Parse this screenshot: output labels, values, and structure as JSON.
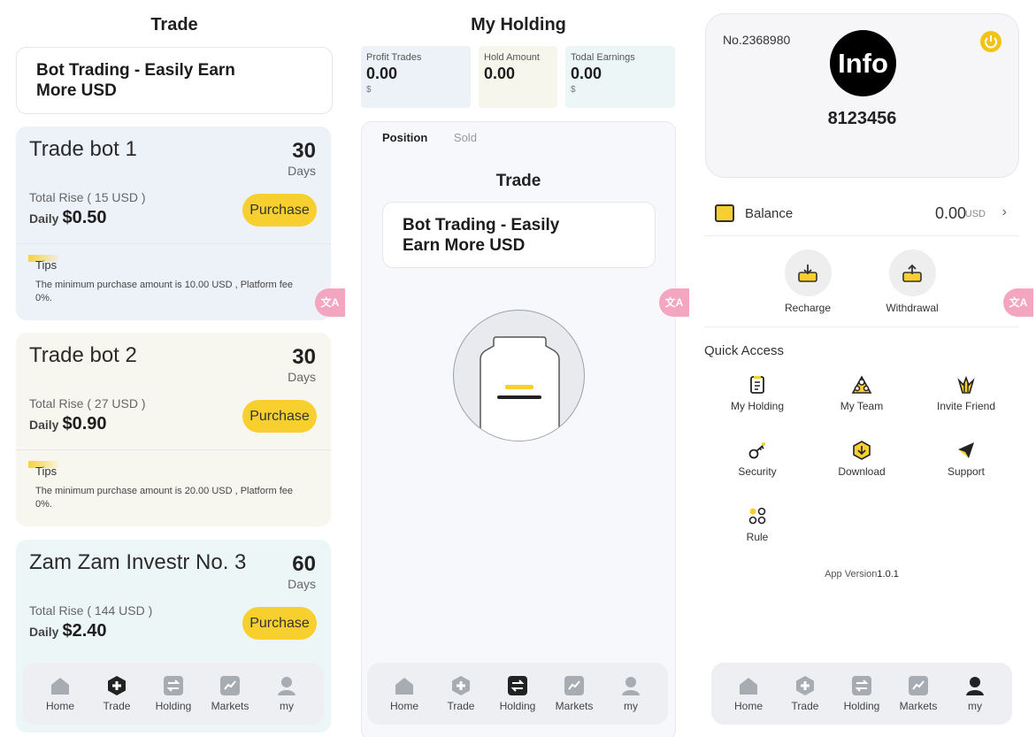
{
  "trade_page": {
    "title": "Trade",
    "banner_line1": "Bot Trading - Easily Earn",
    "banner_line2": "More USD",
    "products": [
      {
        "name": "Trade bot 1",
        "days": "30",
        "days_label": "Days",
        "total_rise": "Total Rise ( 15 USD )",
        "daily_label": "Daily",
        "daily_value": "$0.50",
        "button": "Purchase",
        "tips_label": "Tips",
        "tips_text": "The minimum purchase amount is 10.00 USD , Platform fee 0%.",
        "bg": "#edf1f8"
      },
      {
        "name": "Trade bot 2",
        "days": "30",
        "days_label": "Days",
        "total_rise": "Total Rise ( 27 USD )",
        "daily_label": "Daily",
        "daily_value": "$0.90",
        "button": "Purchase",
        "tips_label": "Tips",
        "tips_text": "The minimum purchase amount is 20.00 USD , Platform fee 0%.",
        "bg": "#f7f7ef"
      },
      {
        "name": "Zam Zam Investr No. 3",
        "days": "60",
        "days_label": "Days",
        "total_rise": "Total Rise ( 144 USD )",
        "daily_label": "Daily",
        "daily_value": "$2.40",
        "button": "Purchase",
        "bg": "#edf6f6"
      }
    ]
  },
  "holding_page": {
    "title": "My Holding",
    "stats": [
      {
        "label": "Profit Trades",
        "value": "0.00",
        "unit": "$",
        "bg": "#edf1f8"
      },
      {
        "label": "Hold Amount",
        "value": "0.00",
        "unit": "",
        "bg": "#f7f6ec"
      },
      {
        "label": "Todal Earnings",
        "value": "0.00",
        "unit": "$",
        "bg": "#edf6f6"
      }
    ],
    "subtabs": [
      "Position",
      "Sold"
    ],
    "section_title": "Trade",
    "banner_line1": "Bot Trading - Easily",
    "banner_line2": "Earn More USD"
  },
  "my_page": {
    "uid": "No.2368980",
    "avatar_text": "Info",
    "nickname": "8123456",
    "balance_label": "Balance",
    "balance_value": "0.00",
    "balance_unit": "USD",
    "actions": [
      "Recharge",
      "Withdrawal"
    ],
    "quick_access_title": "Quick Access",
    "quick_access": [
      "My Holding",
      "My Team",
      "Invite Friend",
      "Security",
      "Download",
      "Support",
      "Rule"
    ],
    "version_label": "App Version",
    "version_value": "1.0.1"
  },
  "translate_label": "文A",
  "nav": [
    "Home",
    "Trade",
    "Holding",
    "Markets",
    "my"
  ],
  "colors": {
    "accent": "#f7cf2e",
    "nav_bg": "#eeeff2",
    "active_icon": "#222222",
    "inactive_icon": "#a7abb2"
  }
}
